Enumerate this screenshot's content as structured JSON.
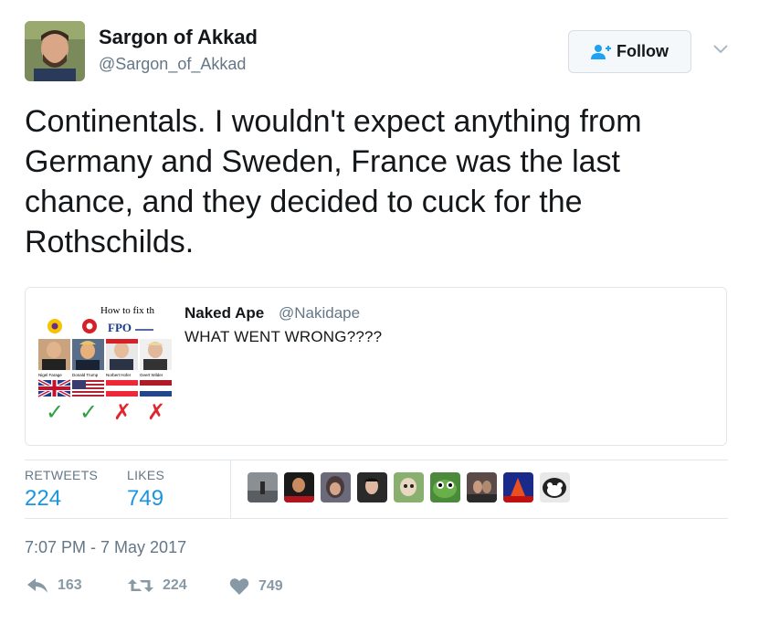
{
  "user": {
    "name": "Sargon of Akkad",
    "handle": "@Sargon_of_Akkad"
  },
  "follow_label": "Follow",
  "tweet_text": "Continentals. I wouldn't expect anything from\nGermany and Sweden, France was the last\nchance, and they decided to cuck for the\nRothschilds.",
  "quote": {
    "name": "Naked Ape",
    "handle": "@Nakidape",
    "text": "WHAT WENT WRONG????",
    "image": {
      "title": "How to fix th",
      "fpo": "FPO",
      "captions": [
        "Nigel Farage",
        "Donald Trump",
        "Norbert Hofer",
        "Geert Wilder"
      ],
      "marks": [
        "✓",
        "✓",
        "✗",
        "✗"
      ]
    }
  },
  "stats": {
    "retweets_label": "RETWEETS",
    "retweets": "224",
    "likes_label": "LIKES",
    "likes": "749"
  },
  "timestamp": "7:07 PM - 7 May 2017",
  "actions": {
    "reply_count": "163",
    "retweet_count": "224",
    "like_count": "749"
  },
  "colors": {
    "link_blue": "#1b95e0",
    "muted": "#657786",
    "action_gray": "#8899a6",
    "border": "#e1e8ed"
  }
}
